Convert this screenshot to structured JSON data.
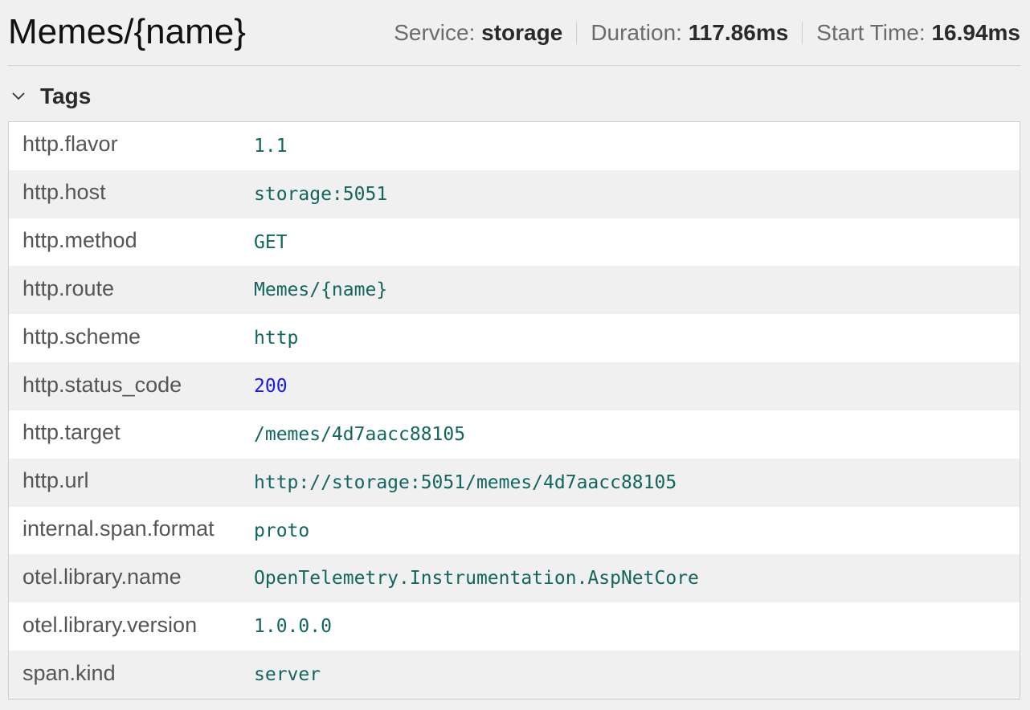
{
  "header": {
    "title": "Memes/{name}",
    "service_label": "Service:",
    "service_value": "storage",
    "duration_label": "Duration:",
    "duration_value": "117.86ms",
    "start_label": "Start Time:",
    "start_value": "16.94ms"
  },
  "tags": {
    "label": "Tags",
    "expanded": true,
    "rows": [
      {
        "key": "http.flavor",
        "value": "1.1"
      },
      {
        "key": "http.host",
        "value": "storage:5051"
      },
      {
        "key": "http.method",
        "value": "GET"
      },
      {
        "key": "http.route",
        "value": "Memes/{name}"
      },
      {
        "key": "http.scheme",
        "value": "http"
      },
      {
        "key": "http.status_code",
        "value": "200"
      },
      {
        "key": "http.target",
        "value": "/memes/4d7aacc88105"
      },
      {
        "key": "http.url",
        "value": "http://storage:5051/memes/4d7aacc88105"
      },
      {
        "key": "internal.span.format",
        "value": "proto"
      },
      {
        "key": "otel.library.name",
        "value": "OpenTelemetry.Instrumentation.AspNetCore"
      },
      {
        "key": "otel.library.version",
        "value": "1.0.0.0"
      },
      {
        "key": "span.kind",
        "value": "server"
      }
    ]
  },
  "colors": {
    "string_value": "#11665f",
    "numeric_value": "#1a1aee"
  }
}
